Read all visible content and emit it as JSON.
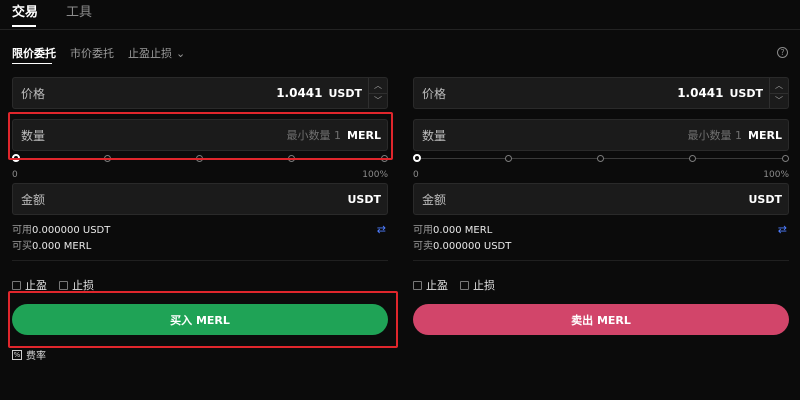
{
  "top_tabs": [
    "交易",
    "工具"
  ],
  "sub_tabs": {
    "limit": "限价委托",
    "market": "市价委托",
    "tpsl": "止盈止损"
  },
  "buy": {
    "price_label": "价格",
    "price_value": "1.0441",
    "price_unit": "USDT",
    "qty_label": "数量",
    "qty_placeholder": "最小数量 1",
    "qty_unit": "MERL",
    "slider_min": "0",
    "slider_max": "100%",
    "amount_label": "金额",
    "amount_unit": "USDT",
    "available_label": "可用",
    "available_value": "0.000000 USDT",
    "can_label": "可买",
    "can_value": "0.000 MERL",
    "take_profit": "止盈",
    "stop_loss": "止损",
    "action_label": "买入 MERL"
  },
  "sell": {
    "price_label": "价格",
    "price_value": "1.0441",
    "price_unit": "USDT",
    "qty_label": "数量",
    "qty_placeholder": "最小数量 1",
    "qty_unit": "MERL",
    "slider_min": "0",
    "slider_max": "100%",
    "amount_label": "金额",
    "amount_unit": "USDT",
    "available_label": "可用",
    "available_value": "0.000 MERL",
    "can_label": "可卖",
    "can_value": "0.000000 USDT",
    "take_profit": "止盈",
    "stop_loss": "止损",
    "action_label": "卖出 MERL"
  },
  "fee_label": "费率",
  "icons": {
    "help": "help-icon",
    "swap": "swap-icon",
    "chevron": "chevron-down-icon",
    "fee": "fee-icon"
  },
  "colors": {
    "buy": "#1fa356",
    "sell": "#d2456a",
    "highlight": "#e0262c",
    "swap": "#4d7cff"
  }
}
